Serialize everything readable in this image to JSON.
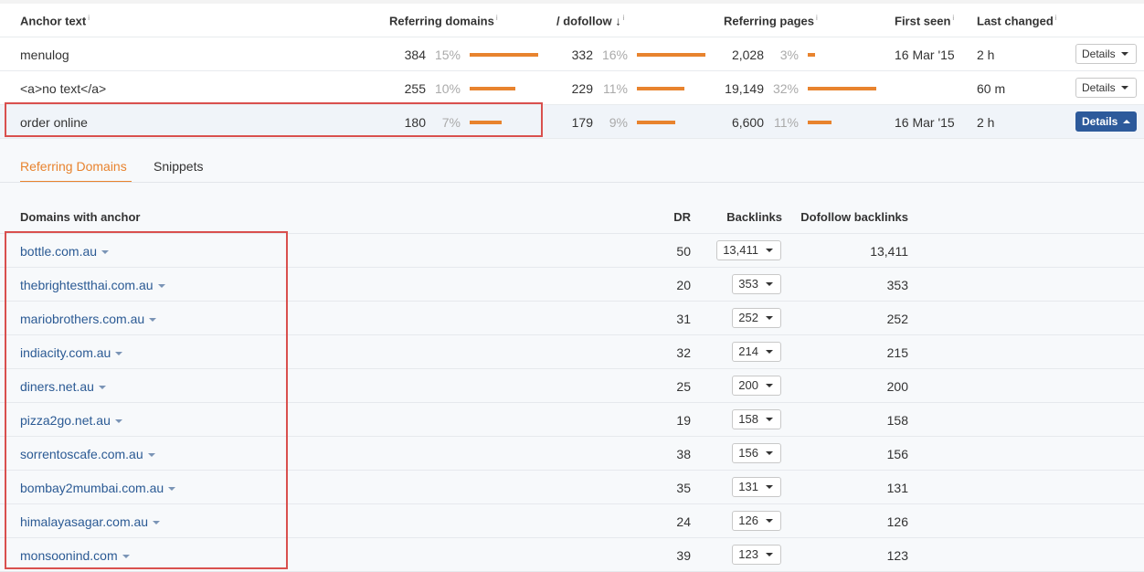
{
  "header": {
    "anchor_text": "Anchor text",
    "referring_domains": "Referring domains",
    "dofollow": "/ dofollow",
    "dofollow_arrow": "↓",
    "referring_pages": "Referring pages",
    "first_seen": "First seen",
    "last_changed": "Last changed",
    "info": "i"
  },
  "rows": [
    {
      "anchor": "menulog",
      "rd": "384",
      "rd_pct": "15%",
      "rd_bar": 0.15,
      "df": "332",
      "df_pct": "16%",
      "df_bar": 0.16,
      "rp": "2,028",
      "rp_pct": "3%",
      "rp_bar": 0.03,
      "first_seen": "16 Mar '15",
      "last_changed": "2 h",
      "details": "Details"
    },
    {
      "anchor": "<a>no text</a>",
      "rd": "255",
      "rd_pct": "10%",
      "rd_bar": 0.1,
      "df": "229",
      "df_pct": "11%",
      "df_bar": 0.11,
      "rp": "19,149",
      "rp_pct": "32%",
      "rp_bar": 0.32,
      "first_seen": "",
      "last_changed": "60 m",
      "details": "Details"
    },
    {
      "anchor": "order online",
      "rd": "180",
      "rd_pct": "7%",
      "rd_bar": 0.07,
      "df": "179",
      "df_pct": "9%",
      "df_bar": 0.09,
      "rp": "6,600",
      "rp_pct": "11%",
      "rp_bar": 0.11,
      "first_seen": "16 Mar '15",
      "last_changed": "2 h",
      "details": "Details"
    }
  ],
  "tabs": {
    "referring_domains": "Referring Domains",
    "snippets": "Snippets"
  },
  "subheader": {
    "domains": "Domains with anchor",
    "dr": "DR",
    "backlinks": "Backlinks",
    "dofollow_backlinks": "Dofollow backlinks"
  },
  "domains": [
    {
      "name": "bottle.com.au",
      "dr": "50",
      "backlinks": "13,411",
      "dofollow": "13,411"
    },
    {
      "name": "thebrightestthai.com.au",
      "dr": "20",
      "backlinks": "353",
      "dofollow": "353"
    },
    {
      "name": "mariobrothers.com.au",
      "dr": "31",
      "backlinks": "252",
      "dofollow": "252"
    },
    {
      "name": "indiacity.com.au",
      "dr": "32",
      "backlinks": "214",
      "dofollow": "215"
    },
    {
      "name": "diners.net.au",
      "dr": "25",
      "backlinks": "200",
      "dofollow": "200"
    },
    {
      "name": "pizza2go.net.au",
      "dr": "19",
      "backlinks": "158",
      "dofollow": "158"
    },
    {
      "name": "sorrentoscafe.com.au",
      "dr": "38",
      "backlinks": "156",
      "dofollow": "156"
    },
    {
      "name": "bombay2mumbai.com.au",
      "dr": "35",
      "backlinks": "131",
      "dofollow": "131"
    },
    {
      "name": "himalayasagar.com.au",
      "dr": "24",
      "backlinks": "126",
      "dofollow": "126"
    },
    {
      "name": "monsoonind.com",
      "dr": "39",
      "backlinks": "123",
      "dofollow": "123"
    }
  ],
  "colors": {
    "accent": "#e8832e",
    "link": "#2b5a94",
    "active_button": "#2d5a9b",
    "highlight": "#d9504e"
  }
}
